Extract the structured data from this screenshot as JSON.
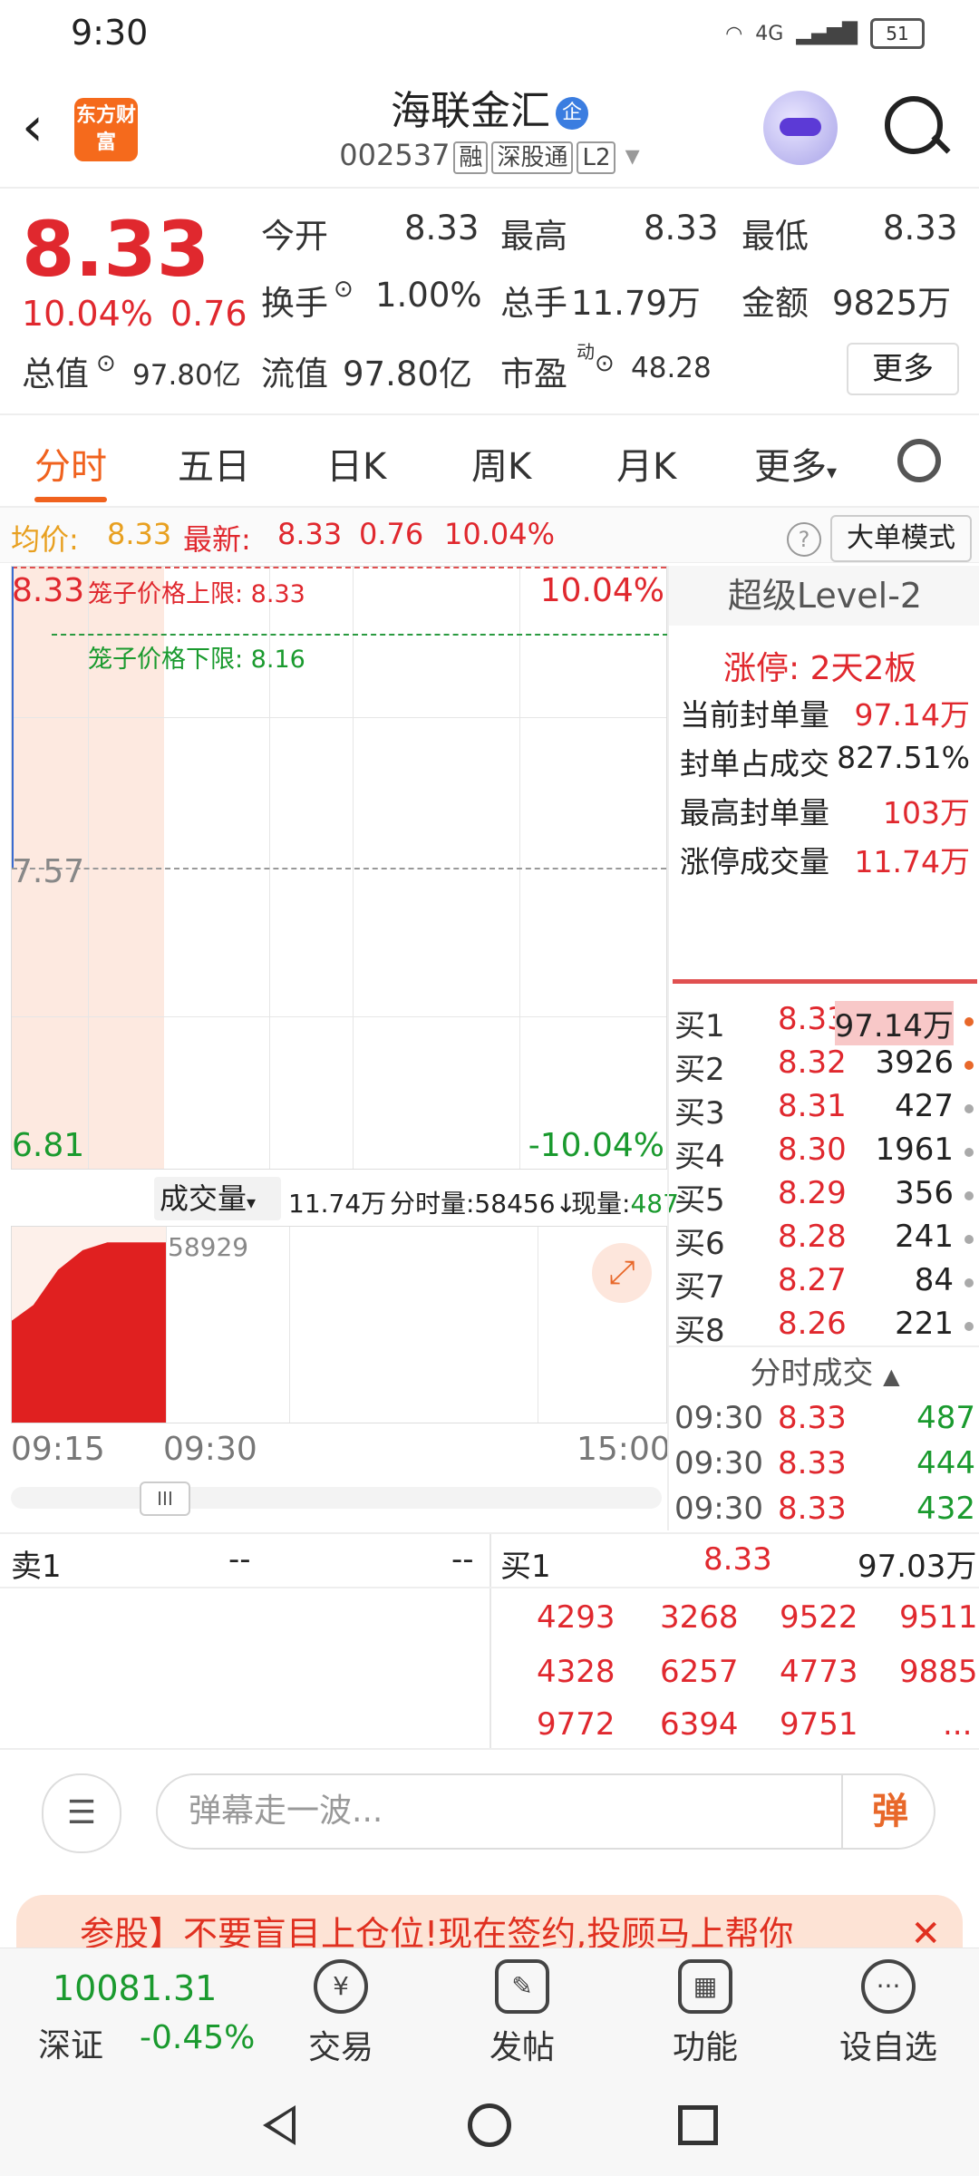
{
  "status": {
    "time": "9:30",
    "network": "4G",
    "battery": "51"
  },
  "header": {
    "logo": "东方财富",
    "title": "海联金汇",
    "verified_badge": "企",
    "code": "002537",
    "tags": [
      "融",
      "深股通",
      "L2"
    ]
  },
  "quote": {
    "price": "8.33",
    "change_pct": "10.04%",
    "change": "0.76",
    "open_label": "今开",
    "open": "8.33",
    "high_label": "最高",
    "high": "8.33",
    "low_label": "最低",
    "low": "8.33",
    "turnover_label": "换手",
    "turnover": "1.00%",
    "volume_label": "总手",
    "volume": "11.79万",
    "amount_label": "金额",
    "amount": "9825万",
    "mktcap_label": "总值",
    "mktcap": "97.80亿",
    "float_label": "流值",
    "float_cap": "97.80亿",
    "pe_label": "市盈",
    "pe_sup": "动",
    "pe": "48.28",
    "more_button": "更多"
  },
  "tabs": [
    "分时",
    "五日",
    "日K",
    "周K",
    "月K",
    "更多"
  ],
  "info": {
    "avg_label": "均价:",
    "avg": "8.33",
    "latest_label": "最新:",
    "latest": "8.33",
    "latest_chg": "0.76",
    "latest_pct": "10.04%",
    "big_order_mode": "大单模式"
  },
  "chart": {
    "upper_price": "8.33",
    "upper_pct": "10.04%",
    "mid_price": "7.57",
    "lower_price": "6.81",
    "lower_pct": "-10.04%",
    "cage_upper": "笼子价格上限: 8.33",
    "cage_lower": "笼子价格下限: 8.16"
  },
  "volume": {
    "selector": "成交量",
    "total": "11.74万",
    "minute": "分时量:58456↓",
    "current_label": "现量:",
    "current": "487",
    "max_label": "58929",
    "time_start": "09:15",
    "time_mid": "09:30",
    "time_end": "15:00"
  },
  "level2": {
    "title": "超级Level-2",
    "limit_up": "涨停: 2天2板",
    "rows": [
      {
        "label": "当前封单量",
        "value": "97.14万"
      },
      {
        "label": "封单占成交",
        "value": "827.51%"
      },
      {
        "label": "最高封单量",
        "value": "103万"
      },
      {
        "label": "涨停成交量",
        "value": "11.74万"
      }
    ],
    "bids": [
      {
        "label": "买1",
        "price": "8.33",
        "qty": "97.14万",
        "dot": "orange"
      },
      {
        "label": "买2",
        "price": "8.32",
        "qty": "3926",
        "dot": "orange"
      },
      {
        "label": "买3",
        "price": "8.31",
        "qty": "427",
        "dot": "gray"
      },
      {
        "label": "买4",
        "price": "8.30",
        "qty": "1961",
        "dot": "gray"
      },
      {
        "label": "买5",
        "price": "8.29",
        "qty": "356",
        "dot": "gray"
      },
      {
        "label": "买6",
        "price": "8.28",
        "qty": "241",
        "dot": "gray"
      },
      {
        "label": "买7",
        "price": "8.27",
        "qty": "84",
        "dot": "gray"
      },
      {
        "label": "买8",
        "price": "8.26",
        "qty": "221",
        "dot": "gray"
      }
    ],
    "ticks_title": "分时成交",
    "ticks": [
      {
        "time": "09:30",
        "price": "8.33",
        "vol": "487"
      },
      {
        "time": "09:30",
        "price": "8.33",
        "vol": "444"
      },
      {
        "time": "09:30",
        "price": "8.33",
        "vol": "432"
      }
    ]
  },
  "queue": {
    "sell_label": "卖1",
    "sell_price": "--",
    "sell_qty": "--",
    "buy_label": "买1",
    "buy_price": "8.33",
    "buy_qty": "97.03万",
    "orders": [
      "4293",
      "3268",
      "9522",
      "9511",
      "4328",
      "6257",
      "4773",
      "9885",
      "9772",
      "6394",
      "9751",
      "..."
    ]
  },
  "comment": {
    "placeholder": "弹幕走一波...",
    "button": "弹"
  },
  "banner": {
    "text": "参股】不要盲目上仓位!现在签约,投顾马上帮你",
    "close": "✕"
  },
  "bottom_nav": {
    "index_value": "10081.31",
    "index_name": "深证",
    "index_change": "-0.45%",
    "items": [
      "交易",
      "发帖",
      "功能",
      "设自选"
    ]
  }
}
